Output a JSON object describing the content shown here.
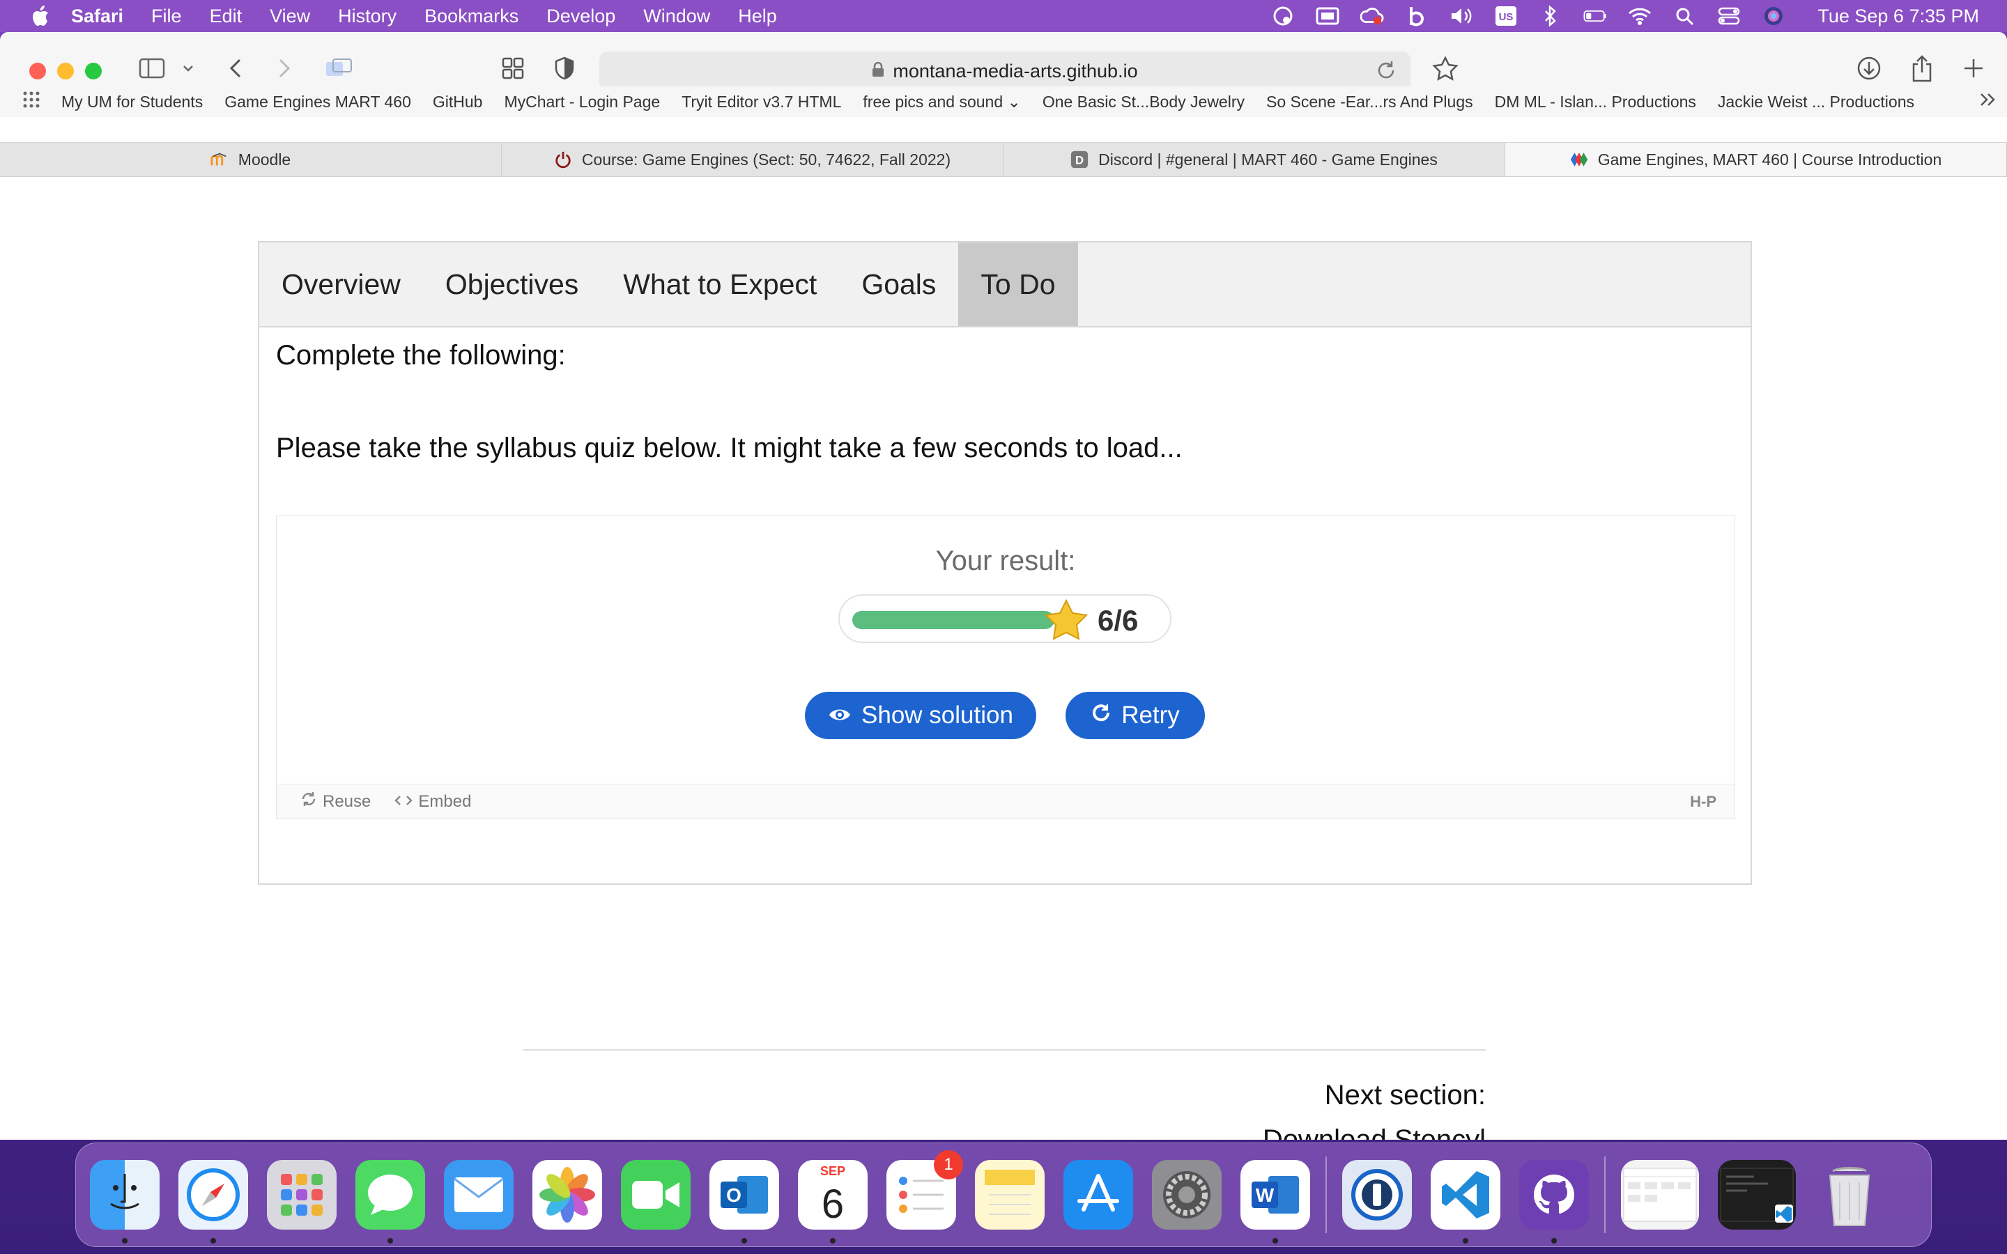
{
  "menubar": {
    "app": "Safari",
    "items": [
      "File",
      "Edit",
      "View",
      "History",
      "Bookmarks",
      "Develop",
      "Window",
      "Help"
    ],
    "clock": "Tue Sep 6  7:35 PM",
    "status_icons": [
      "privacy-icon",
      "screen-mirror-icon",
      "creative-cloud-icon",
      "bold-b-icon",
      "volume-icon",
      "keyboard-input-icon",
      "bluetooth-icon",
      "battery-icon",
      "wifi-icon",
      "search-icon",
      "control-center-icon",
      "siri-icon"
    ],
    "input_source": "US"
  },
  "browser": {
    "url": "montana-media-arts.github.io",
    "bookmarks": [
      "My UM for Students",
      "Game Engines MART 460",
      "GitHub",
      "MyChart - Login Page",
      "Tryit Editor v3.7 HTML",
      "free pics and sound",
      "One Basic St...Body Jewelry",
      "So Scene -Ear...rs And Plugs",
      "DM ML - Islan... Productions",
      "Jackie Weist ... Productions"
    ],
    "tabs": [
      {
        "label": "Moodle",
        "active": false
      },
      {
        "label": "Course: Game Engines (Sect: 50, 74622, Fall 2022)",
        "active": false
      },
      {
        "label": "Discord | #general | MART 460 - Game Engines",
        "active": false
      },
      {
        "label": "Game Engines, MART 460 | Course Introduction",
        "active": true
      }
    ]
  },
  "page": {
    "nav_tabs": [
      "Overview",
      "Objectives",
      "What to Expect",
      "Goals",
      "To Do"
    ],
    "active_tab": "To Do",
    "heading": "Complete the following:",
    "instruction": "Please take the syllabus quiz below. It might take a few seconds to load...",
    "quiz": {
      "result_label": "Your result:",
      "score_text": "6/6",
      "score_fraction": 1.0,
      "show_solution_label": "Show solution",
      "retry_label": "Retry",
      "footer_reuse": "Reuse",
      "footer_embed": "Embed",
      "footer_logo": "H-P"
    },
    "next_section_label": "Next section:",
    "next_section_title": "Download Stencyl"
  },
  "dock": {
    "apps": [
      "Finder",
      "Safari",
      "Launchpad",
      "Messages",
      "Mail",
      "Photos",
      "FaceTime",
      "Outlook",
      "Calendar",
      "Reminders",
      "Notes",
      "App Store",
      "System Preferences",
      "Word",
      "1Password",
      "Visual Studio Code",
      "GitHub Desktop"
    ],
    "calendar_month": "SEP",
    "calendar_day": "6",
    "reminders_badge": "1",
    "colors": {
      "accent": "#1d64d0",
      "progress": "#5bbd7e",
      "menubar": "#8a4fc4"
    }
  }
}
